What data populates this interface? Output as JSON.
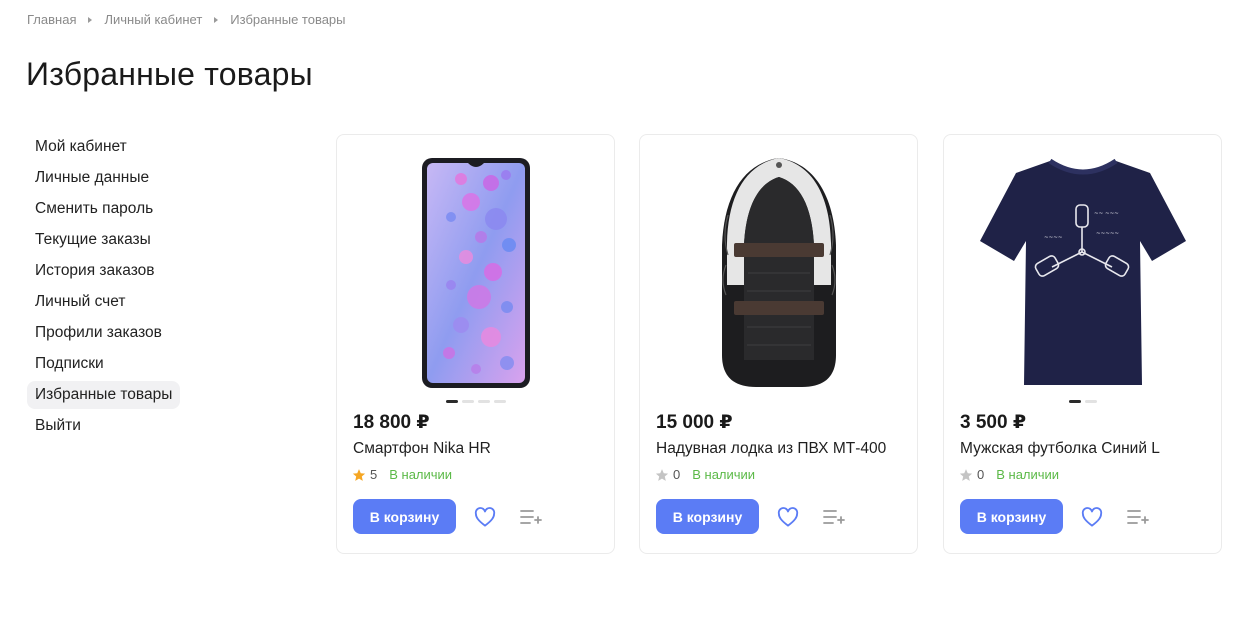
{
  "breadcrumb": [
    "Главная",
    "Личный кабинет",
    "Избранные товары"
  ],
  "page_title": "Избранные товары",
  "sidebar": {
    "items": [
      {
        "label": "Мой кабинет"
      },
      {
        "label": "Личные данные"
      },
      {
        "label": "Сменить пароль"
      },
      {
        "label": "Текущие заказы"
      },
      {
        "label": "История заказов"
      },
      {
        "label": "Личный счет"
      },
      {
        "label": "Профили заказов"
      },
      {
        "label": "Подписки"
      },
      {
        "label": "Избранные товары",
        "active": true
      },
      {
        "label": "Выйти"
      }
    ]
  },
  "products": [
    {
      "price": "18 800 ₽",
      "name": "Смартфон Nika HR",
      "rating": "5",
      "rating_active": true,
      "stock": "В наличии",
      "cart_label": "В корзину",
      "image": "smartphone",
      "slides": 4,
      "current_slide": 1
    },
    {
      "price": "15 000 ₽",
      "name": "Надувная лодка из ПВХ МТ-400",
      "rating": "0",
      "rating_active": false,
      "stock": "В наличии",
      "cart_label": "В корзину",
      "image": "inflatable-boat",
      "slides": 0,
      "current_slide": 0
    },
    {
      "price": "3 500 ₽",
      "name": "Мужская футболка Синий L",
      "rating": "0",
      "rating_active": false,
      "stock": "В наличии",
      "cart_label": "В корзину",
      "image": "t-shirt",
      "slides": 2,
      "current_slide": 1
    }
  ],
  "colors": {
    "accent": "#5b7cf5",
    "in_stock": "#5bb947",
    "star_active": "#f5a623",
    "star_inactive": "#c4c4c4"
  }
}
